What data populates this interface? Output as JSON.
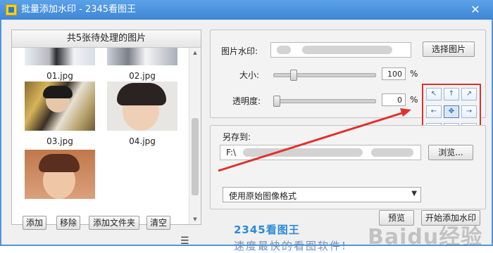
{
  "window": {
    "title": "批量添加水印 - 2345看图王",
    "close_glyph": "✕"
  },
  "left_panel": {
    "header": "共5张待处理的图片",
    "thumbnails": [
      {
        "label": "01.jpg"
      },
      {
        "label": "02.jpg"
      },
      {
        "label": "03.jpg"
      },
      {
        "label": "04.jpg"
      },
      {
        "label": ""
      }
    ],
    "buttons": {
      "add": "添加",
      "remove": "移除",
      "add_folder": "添加文件夹",
      "clear": "清空"
    },
    "list_icon": "☰"
  },
  "watermark_settings": {
    "image_label": "图片水印:",
    "select_image_button": "选择图片",
    "size_label": "大小:",
    "size_value": "100",
    "size_unit": "%",
    "opacity_label": "透明度:",
    "opacity_value": "0",
    "opacity_unit": "%",
    "size_slider_level": 1.0,
    "opacity_slider_level": 0.0,
    "position_grid": {
      "icons": [
        "top-left-icon",
        "top-center-icon",
        "top-right-icon",
        "middle-left-icon",
        "center-icon",
        "middle-right-icon",
        "bottom-left-icon",
        "bottom-center-icon",
        "bottom-right-icon"
      ],
      "glyphs": [
        "↖",
        "↑",
        "↗",
        "←",
        "✥",
        "→",
        "↙",
        "↓",
        "↘"
      ],
      "selected_index": 4
    }
  },
  "save_settings": {
    "save_to_label": "另存到:",
    "path_prefix": "F:\\",
    "browse_button": "浏览...",
    "format_select_value": "使用原始图像格式",
    "format_arrow": "▼"
  },
  "footer": {
    "watermark_logo": "2345看图王",
    "tagline": "速度最快的看图软件!",
    "preview_button": "预览",
    "start_button": "开始添加水印",
    "baidu_overlay": "Baidu经验"
  },
  "colors": {
    "titlebar": "#3f86d6",
    "highlight_box": "#e0312c",
    "arrow": "#e0312c",
    "watermark_blue": "#2c8ad8"
  }
}
